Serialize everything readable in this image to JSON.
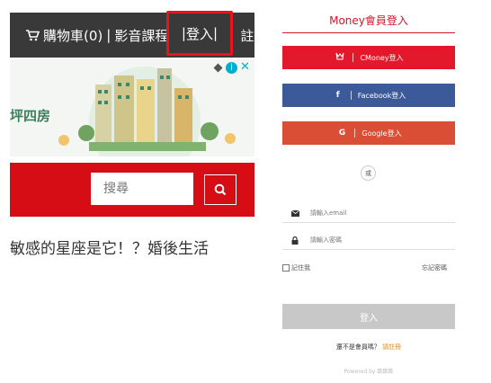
{
  "site": {
    "nav": {
      "cart_label": "購物車(0)",
      "separator": "|",
      "video_label": "影音課程",
      "login_label": "登入",
      "register_label": "註冊"
    },
    "ad": {
      "label": "坪四房",
      "info_icon": "info-icon",
      "close_icon": "close-icon"
    },
    "search": {
      "placeholder": "搜尋",
      "button_icon": "search-icon"
    },
    "headline": "敏感的星座是它！？婚後生活"
  },
  "login_panel": {
    "title": "Money會員登入",
    "cmoney_label": "CMoney登入",
    "facebook_label": "Facebook登入",
    "google_label": "Google登入",
    "facebook_icon_text": "f",
    "google_icon_text": "G",
    "or_label": "或",
    "email_placeholder": "請輸入email",
    "password_placeholder": "請輸入密碼",
    "remember_label": "記住我",
    "forgot_label": "忘記密碼",
    "submit_label": "登入",
    "register_prompt": "還不是會員嗎？",
    "register_link": "請註冊",
    "powered_by": "Powered by 跳跳跳",
    "colors": {
      "accent": "#d5152b",
      "facebook": "#3c5a99",
      "google": "#db4e36",
      "disabled": "#c8c8c8"
    }
  }
}
